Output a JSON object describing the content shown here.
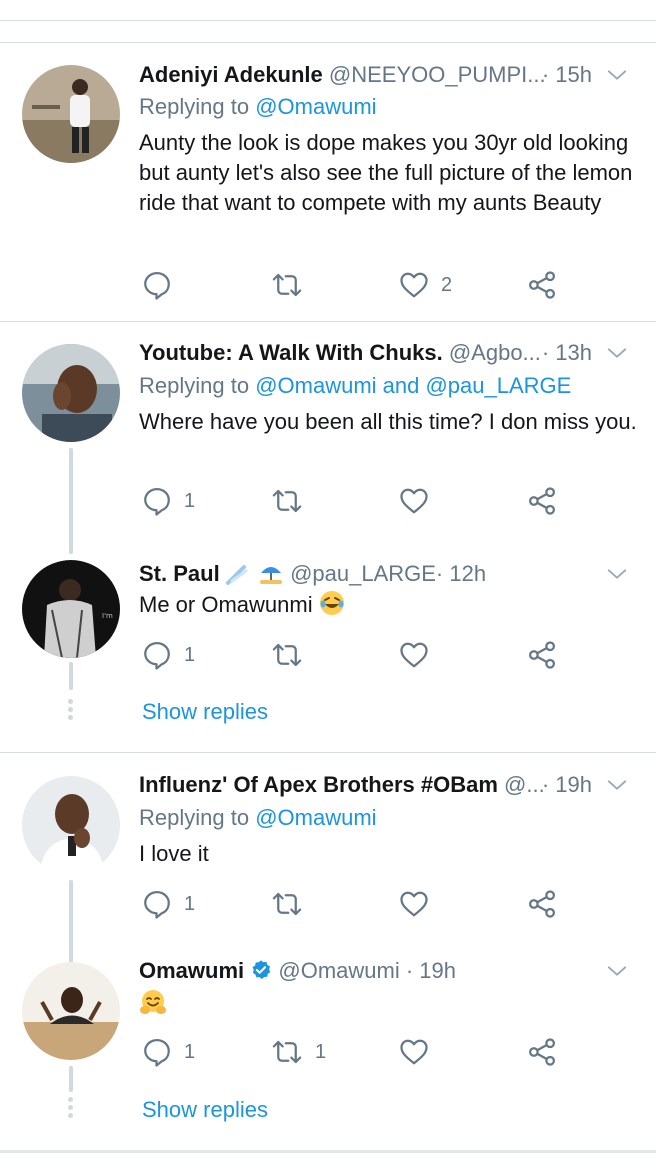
{
  "tweets": [
    {
      "name": "Adeniyi Adekunle",
      "handle": "@NEEYOO_PUMPI...",
      "time": "· 15h",
      "replying_prefix": "Replying to",
      "replying_to": "@Omawumi",
      "text": "Aunty the look is dope makes you 30yr old looking but aunty let's also see the full picture of the lemon ride that want to compete with my aunts Beauty",
      "like_count": "2"
    },
    {
      "name": "Youtube: A Walk With Chuks.",
      "handle": "@Agbo...",
      "time": "· 13h",
      "replying_prefix": "Replying to",
      "replying_to": "@Omawumi and @pau_LARGE",
      "text": "Where have you been all this time? I don miss you.",
      "reply_count": "1"
    },
    {
      "name": "St. Paul",
      "handle": "@pau_LARGE",
      "time": "· 12h",
      "text": "Me or Omawunmi",
      "reply_count": "1"
    },
    {
      "name": "Influenz' Of Apex Brothers #OBam",
      "handle": "@...",
      "time": "· 19h",
      "replying_prefix": "Replying to",
      "replying_to": "@Omawumi",
      "text": "I love it",
      "reply_count": "1"
    },
    {
      "name": "Omawumi",
      "handle": "@Omawumi",
      "time": "· 19h",
      "reply_count": "1",
      "retweet_count": "1"
    }
  ],
  "show_replies_label": "Show replies",
  "icons": {
    "reply": "reply-icon",
    "retweet": "retweet-icon",
    "like": "heart-icon",
    "share": "share-icon",
    "more": "chevron-down-icon",
    "verified": "verified-badge-icon"
  },
  "colors": {
    "link": "#1b95e0",
    "muted": "#657786",
    "divider": "#d6dde3",
    "thread": "#cfd9de"
  }
}
